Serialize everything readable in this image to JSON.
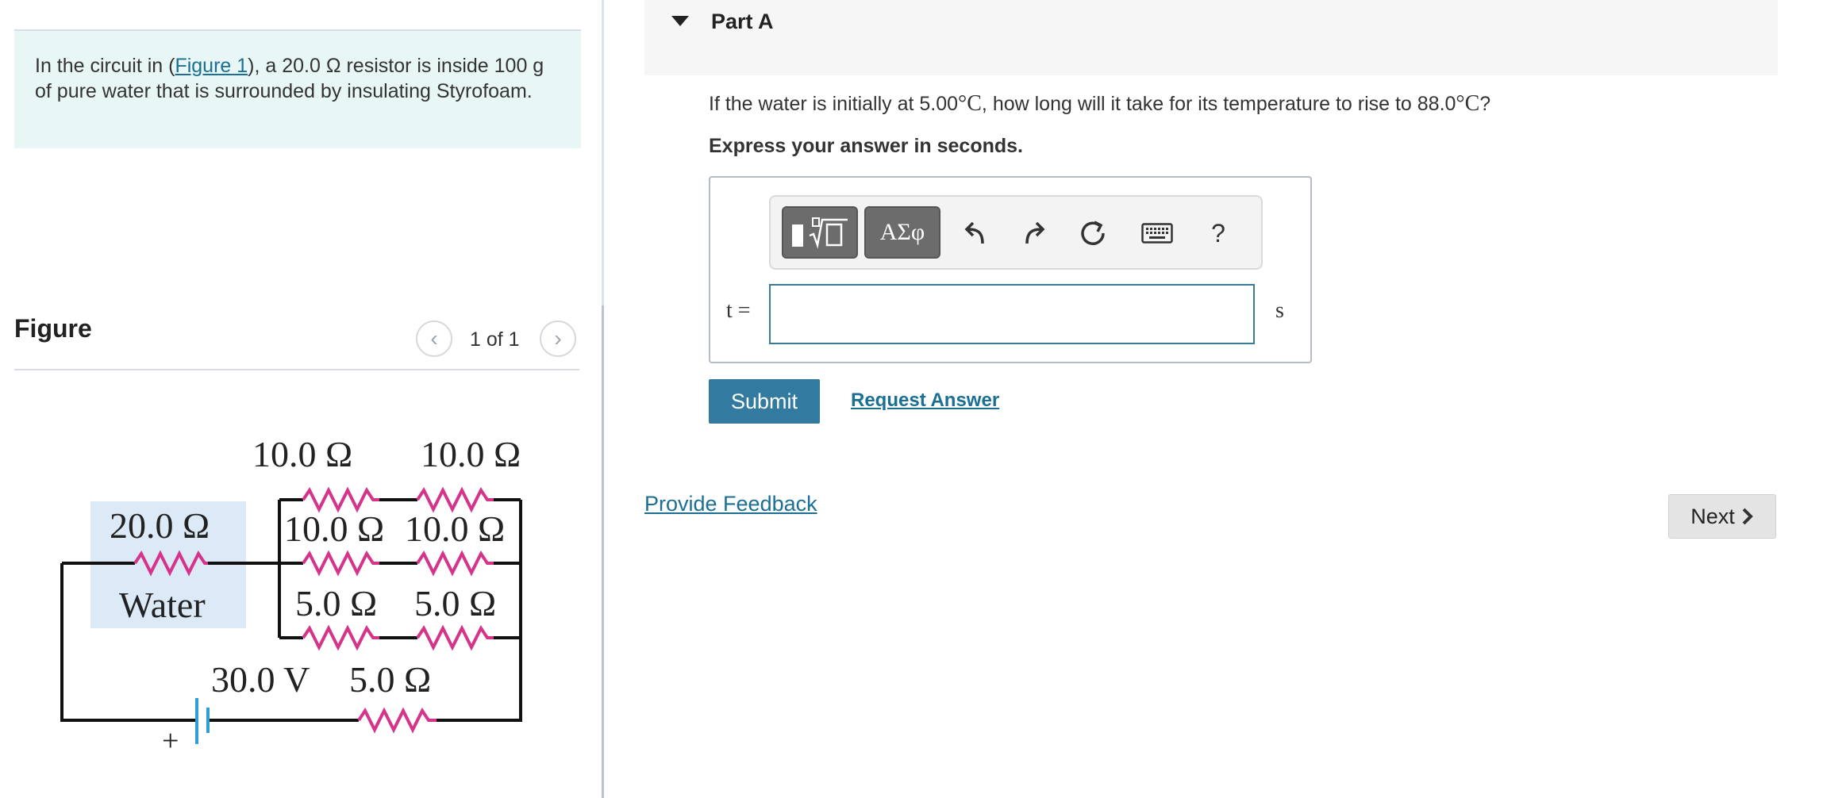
{
  "problem": {
    "text_before": "In the circuit in (",
    "figure_link": "Figure 1",
    "text_after": "), a 20.0 Ω resistor is inside 100 g of pure water that is surrounded by insulating Styrofoam."
  },
  "figure": {
    "title": "Figure",
    "counter": "1 of 1",
    "labels": {
      "r_top_left": "10.0 Ω",
      "r_top_right": "10.0 Ω",
      "r_mid_left": "10.0 Ω",
      "r_mid_right": "10.0 Ω",
      "r_low_left": "5.0 Ω",
      "r_low_right": "5.0 Ω",
      "r_water": "20.0 Ω",
      "water": "Water",
      "voltage": "30.0 V",
      "r_bottom": "5.0 Ω",
      "plus": "+"
    },
    "colors": {
      "resistor": "#d6338a",
      "water_bg": "#dbeaf6",
      "battery": "#2e9fd6"
    }
  },
  "part": {
    "title": "Part A",
    "question_start": "If the water is initially at 5.00",
    "question_unit1": "°C",
    "question_mid": ", how long will it take for its temperature to rise to 88.0",
    "question_unit2": "°C",
    "question_end": "?",
    "instruction": "Express your answer in seconds."
  },
  "toolbar": {
    "symbols_label": "ΑΣφ",
    "help_label": "?",
    "icons": [
      "templates-icon",
      "undo-icon",
      "redo-icon",
      "reset-icon",
      "keyboard-icon"
    ]
  },
  "answer": {
    "variable": "t =",
    "value": "",
    "unit": "s"
  },
  "buttons": {
    "submit": "Submit",
    "request_answer": "Request Answer",
    "provide_feedback": "Provide Feedback",
    "next": "Next"
  },
  "colors": {
    "primary": "#327aa0",
    "link": "#1a6f93",
    "problem_bg": "#e8f6f6"
  }
}
